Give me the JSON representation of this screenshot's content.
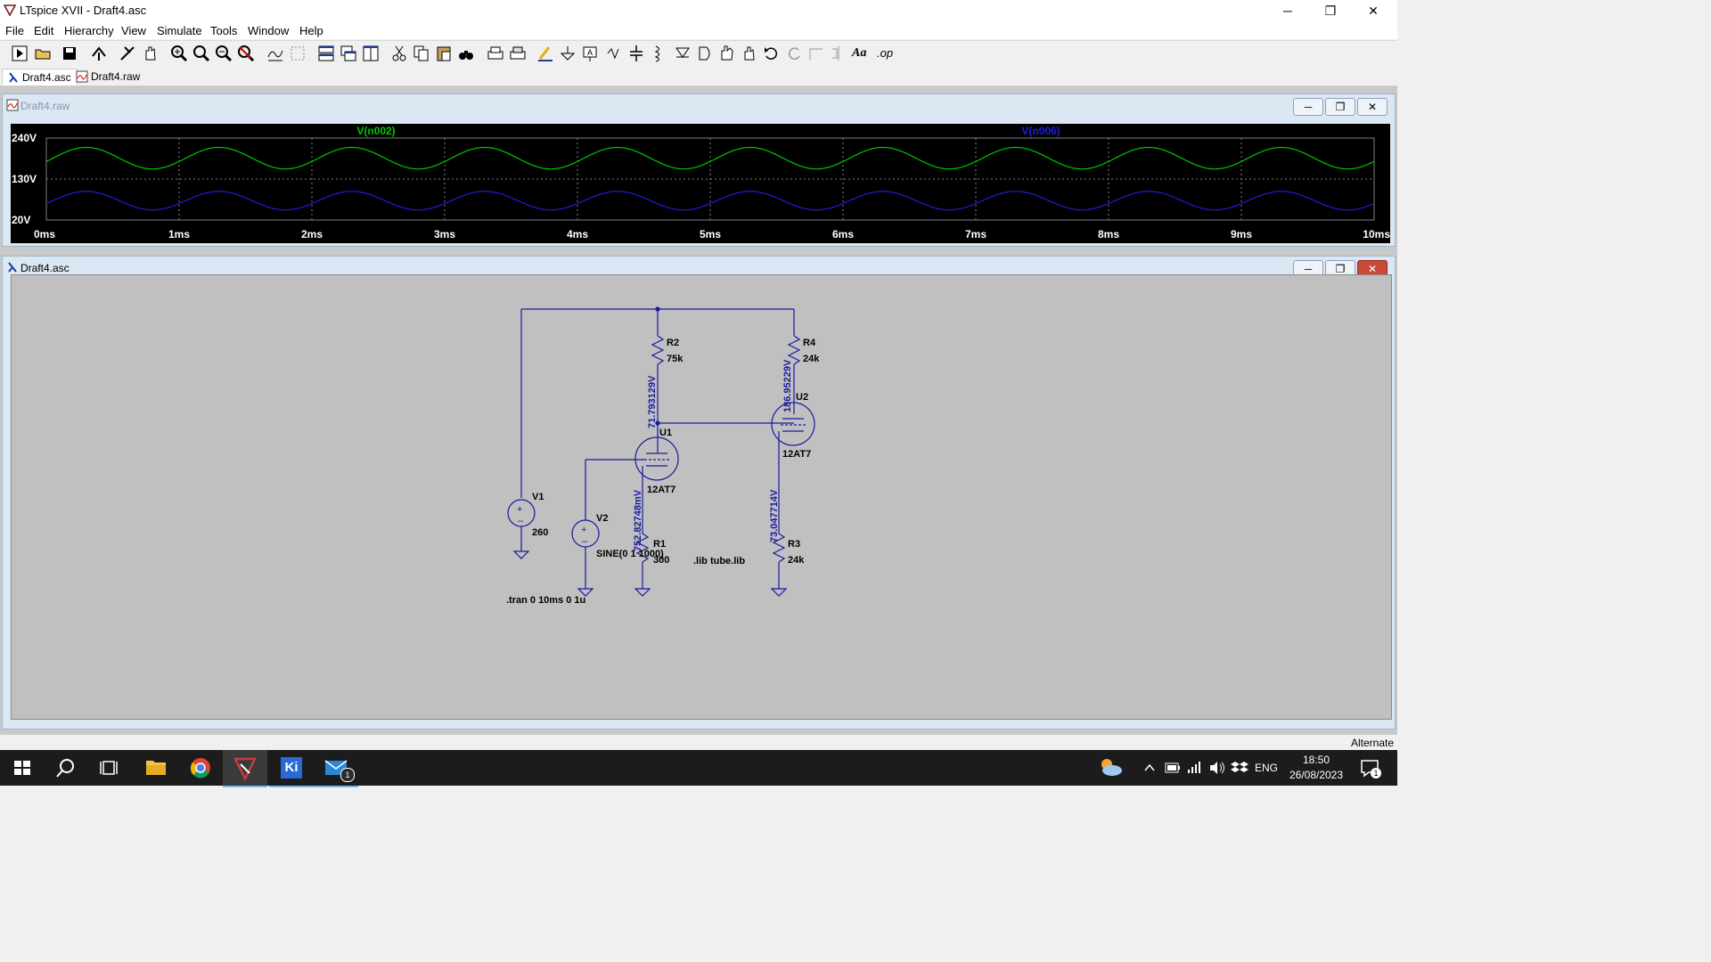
{
  "window": {
    "title": "LTspice XVII - Draft4.asc",
    "minimize": "─",
    "restore": "❐",
    "close": "✕"
  },
  "menu": [
    "File",
    "Edit",
    "Hierarchy",
    "View",
    "Simulate",
    "Tools",
    "Window",
    "Help"
  ],
  "menu_hotkeys": [
    "F",
    "E",
    "H",
    "V",
    "S",
    "T",
    "W",
    "H"
  ],
  "tabs": [
    {
      "label": "Draft4.asc",
      "icon": "schematic-icon"
    },
    {
      "label": "Draft4.raw",
      "icon": "waveform-icon"
    }
  ],
  "toolbar_text": {
    "font_tool": "Aa",
    "op_tool": ".op"
  },
  "waveform_window": {
    "title": "Draft4.raw",
    "chart_data": {
      "type": "line",
      "x": [
        "0ms",
        "1ms",
        "2ms",
        "3ms",
        "4ms",
        "5ms",
        "6ms",
        "7ms",
        "8ms",
        "9ms",
        "10ms"
      ],
      "xlim": [
        0,
        10
      ],
      "ylim": [
        20,
        240
      ],
      "y_ticks": [
        "240V",
        "130V",
        "20V"
      ],
      "grid": true,
      "series": [
        {
          "name": "V(n002)",
          "color": "#00c800",
          "frequency_per_ms": 1,
          "center": 186,
          "amplitude": 29
        },
        {
          "name": "V(n006)",
          "color": "#1e1ee0",
          "frequency_per_ms": 1,
          "center": 72,
          "amplitude": 25
        }
      ]
    }
  },
  "schematic_window": {
    "title": "Draft4.asc",
    "components": {
      "r2": {
        "name": "R2",
        "value": "75k"
      },
      "r4": {
        "name": "R4",
        "value": "24k"
      },
      "u1": {
        "name": "U1",
        "model": "12AT7"
      },
      "u2": {
        "name": "U2",
        "model": "12AT7"
      },
      "v1": {
        "name": "V1",
        "value": "260"
      },
      "v2": {
        "name": "V2",
        "value": "SINE(0 1 1000)"
      },
      "r1": {
        "name": "R1",
        "value": "300"
      },
      "r3": {
        "name": "R3",
        "value": "24k"
      }
    },
    "voltage_labels": {
      "u1_plate": "71.793129V",
      "u2_plate": "186.95229V",
      "u1_cathode": "752.82748mV",
      "u2_cathode": "73.047714V"
    },
    "directives": {
      "lib": ".lib tube.lib",
      "tran": ".tran 0 10ms 0 1u"
    }
  },
  "status": {
    "right": "Alternate"
  },
  "taskbar": {
    "apps": [
      "start-icon",
      "search-icon",
      "task-view-icon",
      "file-explorer-icon",
      "chrome-icon",
      "ltspice-icon",
      "kicad-icon",
      "mail-icon"
    ],
    "language": "ENG",
    "time": "18:50",
    "date": "26/08/2023",
    "mail_badge": "1",
    "notification_badge": "1",
    "kicad_label": "Ki"
  }
}
